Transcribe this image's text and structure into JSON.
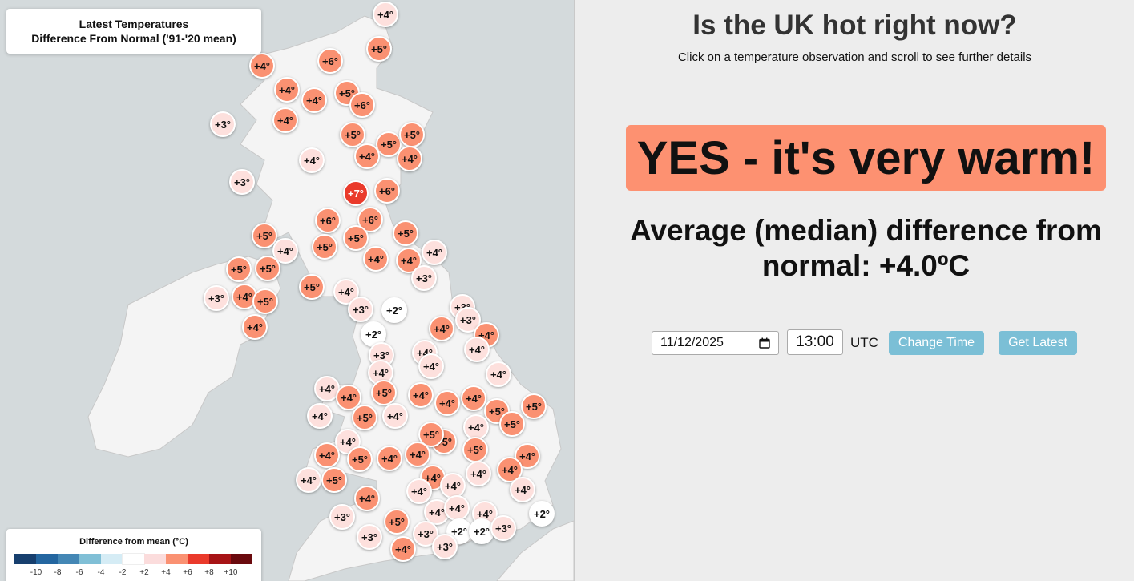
{
  "map": {
    "title_line1": "Latest Temperatures",
    "title_line2": "Difference From Normal ('91-'20 mean)",
    "legend": {
      "title": "Difference from mean (°C)",
      "colors": [
        "#173f6e",
        "#2466a0",
        "#4487b5",
        "#80bfd6",
        "#d5ecf5",
        "#ffffff",
        "#fbdcdc",
        "#fa9172",
        "#ea3a2b",
        "#a71416",
        "#6a0a0e"
      ],
      "ticks": [
        "-10",
        "-8",
        "-6",
        "-4",
        "-2",
        "+2",
        "+4",
        "+6",
        "+8",
        "+10"
      ]
    },
    "markers": [
      {
        "label": "+4°",
        "level": "4"
      },
      {
        "label": "+5°",
        "level": "5"
      },
      {
        "label": "+4°",
        "level": "4"
      },
      {
        "label": "+6°",
        "level": "6"
      },
      {
        "label": "+4°",
        "level": "4"
      },
      {
        "label": "+4°",
        "level": "4"
      },
      {
        "label": "+5°",
        "level": "5"
      },
      {
        "label": "+6°",
        "level": "6"
      },
      {
        "label": "+3°",
        "level": "3"
      },
      {
        "label": "+4°",
        "level": "4"
      },
      {
        "label": "+5°",
        "level": "5"
      },
      {
        "label": "+5°",
        "level": "5"
      },
      {
        "label": "+5°",
        "level": "5"
      },
      {
        "label": "+4°",
        "level": "4"
      },
      {
        "label": "+4°",
        "level": "4"
      },
      {
        "label": "+4°",
        "level": "4"
      },
      {
        "label": "+3°",
        "level": "3"
      },
      {
        "label": "+7°",
        "level": "7"
      },
      {
        "label": "+6°",
        "level": "6"
      },
      {
        "label": "+6°",
        "level": "6"
      },
      {
        "label": "+6°",
        "level": "6"
      },
      {
        "label": "+5°",
        "level": "5"
      },
      {
        "label": "+5°",
        "level": "5"
      },
      {
        "label": "+5°",
        "level": "5"
      },
      {
        "label": "+4°",
        "level": "4"
      },
      {
        "label": "+5°",
        "level": "5"
      },
      {
        "label": "+4°",
        "level": "4"
      },
      {
        "label": "+4°",
        "level": "4"
      },
      {
        "label": "+5°",
        "level": "5"
      },
      {
        "label": "+5°",
        "level": "5"
      },
      {
        "label": "+4°",
        "level": "4"
      },
      {
        "label": "+3°",
        "level": "3"
      },
      {
        "label": "+3°",
        "level": "3"
      },
      {
        "label": "+4°",
        "level": "4"
      },
      {
        "label": "+5°",
        "level": "5"
      },
      {
        "label": "+4°",
        "level": "4"
      },
      {
        "label": "+5°",
        "level": "5"
      },
      {
        "label": "+4°",
        "level": "4"
      },
      {
        "label": "+3°",
        "level": "3"
      },
      {
        "label": "+2°",
        "level": "2"
      },
      {
        "label": "+3°",
        "level": "3"
      },
      {
        "label": "+3°",
        "level": "3"
      },
      {
        "label": "+4°",
        "level": "4"
      },
      {
        "label": "+4°",
        "level": "4"
      },
      {
        "label": "+2°",
        "level": "2"
      },
      {
        "label": "+4°",
        "level": "4"
      },
      {
        "label": "+3°",
        "level": "3"
      },
      {
        "label": "+4°",
        "level": "4"
      },
      {
        "label": "+4°",
        "level": "4"
      },
      {
        "label": "+4°",
        "level": "4"
      },
      {
        "label": "+4°",
        "level": "4"
      },
      {
        "label": "+4°",
        "level": "4"
      },
      {
        "label": "+5°",
        "level": "5"
      },
      {
        "label": "+4°",
        "level": "4"
      },
      {
        "label": "+4°",
        "level": "4"
      },
      {
        "label": "+5°",
        "level": "5"
      },
      {
        "label": "+4°",
        "level": "4"
      },
      {
        "label": "+4°",
        "level": "4"
      },
      {
        "label": "+4°",
        "level": "4"
      },
      {
        "label": "+5°",
        "level": "5"
      },
      {
        "label": "+5°",
        "level": "5"
      },
      {
        "label": "+4°",
        "level": "4"
      },
      {
        "label": "+4°",
        "level": "4"
      },
      {
        "label": "+5°",
        "level": "5"
      },
      {
        "label": "+4°",
        "level": "4"
      },
      {
        "label": "+5°",
        "level": "5"
      },
      {
        "label": "+5°",
        "level": "5"
      },
      {
        "label": "+5°",
        "level": "5"
      },
      {
        "label": "+4°",
        "level": "4"
      },
      {
        "label": "+5°",
        "level": "5"
      },
      {
        "label": "+4°",
        "level": "4"
      },
      {
        "label": "+4°",
        "level": "4"
      },
      {
        "label": "+4°",
        "level": "4"
      },
      {
        "label": "+4°",
        "level": "4"
      },
      {
        "label": "+4°",
        "level": "4"
      },
      {
        "label": "+4°",
        "level": "4"
      },
      {
        "label": "+5°",
        "level": "5"
      },
      {
        "label": "+4°",
        "level": "4"
      },
      {
        "label": "+4°",
        "level": "4"
      },
      {
        "label": "+4°",
        "level": "4"
      },
      {
        "label": "+4°",
        "level": "4"
      },
      {
        "label": "+4°",
        "level": "4"
      },
      {
        "label": "+2°",
        "level": "2"
      },
      {
        "label": "+4°",
        "level": "4"
      },
      {
        "label": "+4°",
        "level": "4"
      },
      {
        "label": "+4°",
        "level": "4"
      },
      {
        "label": "+5°",
        "level": "5"
      },
      {
        "label": "+3°",
        "level": "3"
      },
      {
        "label": "+3°",
        "level": "3"
      },
      {
        "label": "+3°",
        "level": "3"
      },
      {
        "label": "+2°",
        "level": "2"
      },
      {
        "label": "+2°",
        "level": "2"
      },
      {
        "label": "+3°",
        "level": "3"
      },
      {
        "label": "+4°",
        "level": "4"
      },
      {
        "label": "+3°",
        "level": "3"
      }
    ]
  },
  "header": {
    "title": "Is the UK hot right now?",
    "subtitle": "Click on a temperature observation and scroll to see further details"
  },
  "verdict": {
    "text": "YES - it's very warm!",
    "color": "#fd9171"
  },
  "median": {
    "text": "Average (median) difference from normal: +4.0ºC"
  },
  "controls": {
    "date_value": "11/12/2025",
    "time_value": "13:00",
    "tz_label": "UTC",
    "change_time_label": "Change Time",
    "get_latest_label": "Get Latest",
    "calendar_icon": "calendar-icon"
  }
}
